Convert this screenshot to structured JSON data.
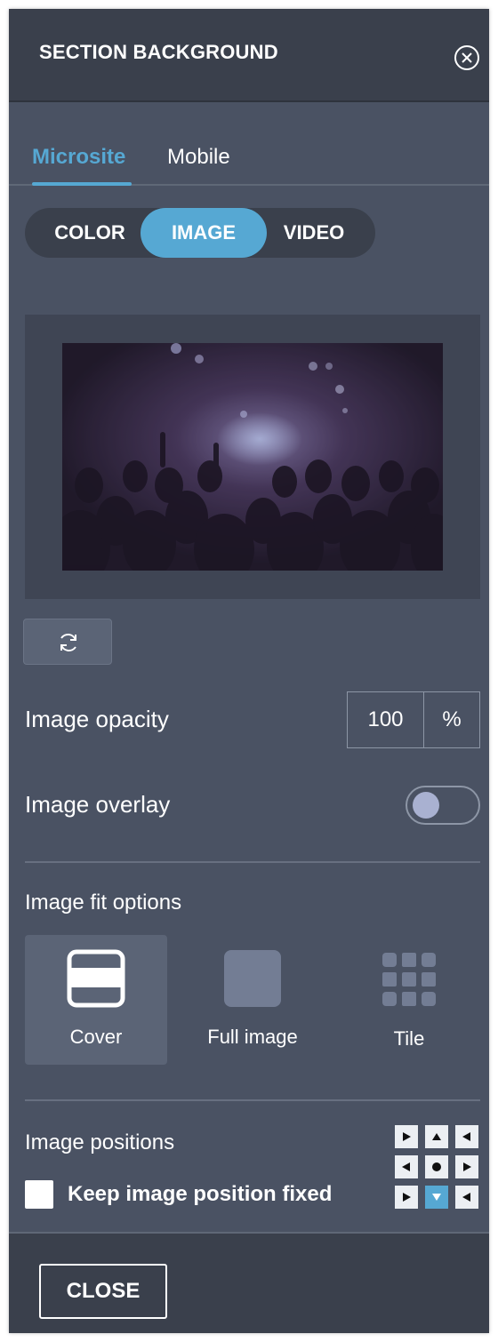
{
  "header": {
    "title": "SECTION BACKGROUND"
  },
  "tabs": [
    {
      "label": "Microsite",
      "active": true
    },
    {
      "label": "Mobile",
      "active": false
    }
  ],
  "background_type": {
    "options": [
      "COLOR",
      "IMAGE",
      "VIDEO"
    ],
    "selected": "IMAGE"
  },
  "preview": {
    "icon": "concert-crowd-photo"
  },
  "replace": {
    "icon": "refresh-icon"
  },
  "opacity": {
    "label": "Image opacity",
    "value": "100",
    "unit": "%"
  },
  "overlay": {
    "label": "Image overlay",
    "enabled": false
  },
  "fit": {
    "label": "Image fit options",
    "options": [
      {
        "label": "Cover",
        "icon": "cover-fit-icon",
        "selected": true
      },
      {
        "label": "Full image",
        "icon": "full-image-fit-icon",
        "selected": false
      },
      {
        "label": "Tile",
        "icon": "tile-fit-icon",
        "selected": false
      }
    ]
  },
  "positions": {
    "label": "Image positions",
    "selected": "bottom-center",
    "keep_fixed_label": "Keep image position fixed",
    "keep_fixed_checked": false
  },
  "footer": {
    "close_label": "CLOSE"
  },
  "colors": {
    "accent": "#56a8d3",
    "panel": "#4a5263",
    "header": "#3a404c"
  }
}
